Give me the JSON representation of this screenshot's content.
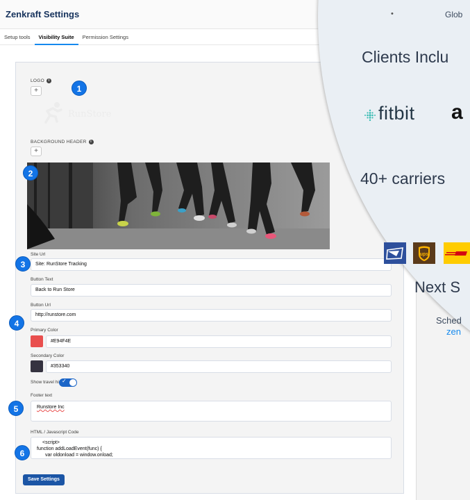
{
  "window": {
    "title": "Zenkraft Settings",
    "tabs": [
      {
        "label": "Setup tools",
        "active": false
      },
      {
        "label": "Visibility Suite",
        "active": true
      },
      {
        "label": "Permission Settings",
        "active": false
      }
    ]
  },
  "form": {
    "logo_label": "LOGO",
    "logo_text": "RunStore",
    "background_header_label": "BACKGROUND HEADER",
    "site_url": {
      "label": "Site Url",
      "value": "Site: RunStore Tracking"
    },
    "button_text": {
      "label": "Button Text",
      "value": "Back to Run Store"
    },
    "button_url": {
      "label": "Button Url",
      "value": "http://runstore.com"
    },
    "primary_color": {
      "label": "Primary Color",
      "value": "#E94F4E",
      "swatch": "#e94f4e"
    },
    "secondary_color": {
      "label": "Secondary Color",
      "value": "#353340",
      "swatch": "#353340"
    },
    "show_travel_history": {
      "label": "Show travel history",
      "on": true
    },
    "footer_text": {
      "label": "Footer text",
      "value": "Runstore Inc"
    },
    "html_code": {
      "label": "HTML / Javascript Code",
      "lines": [
        "<script>",
        "function addLoadEvent(func) {",
        "  var oldonload = window.onload;"
      ]
    },
    "save_label": "Save Settings"
  },
  "badges": [
    "1",
    "2",
    "3",
    "4",
    "5",
    "6"
  ],
  "marketing": {
    "bullet": "•",
    "bullet_text": "Glob",
    "clients_heading": "Clients Inclu",
    "client_logo_1": "fitbit",
    "client_logo_2": "a",
    "carriers_text": "40+ carriers",
    "next_heading": "Next S",
    "schedule_text": "Sched",
    "link_text": "zen"
  },
  "colors": {
    "accent_blue": "#1374e6",
    "save_button": "#1b55a5",
    "panel_bg": "#eaeff4"
  }
}
